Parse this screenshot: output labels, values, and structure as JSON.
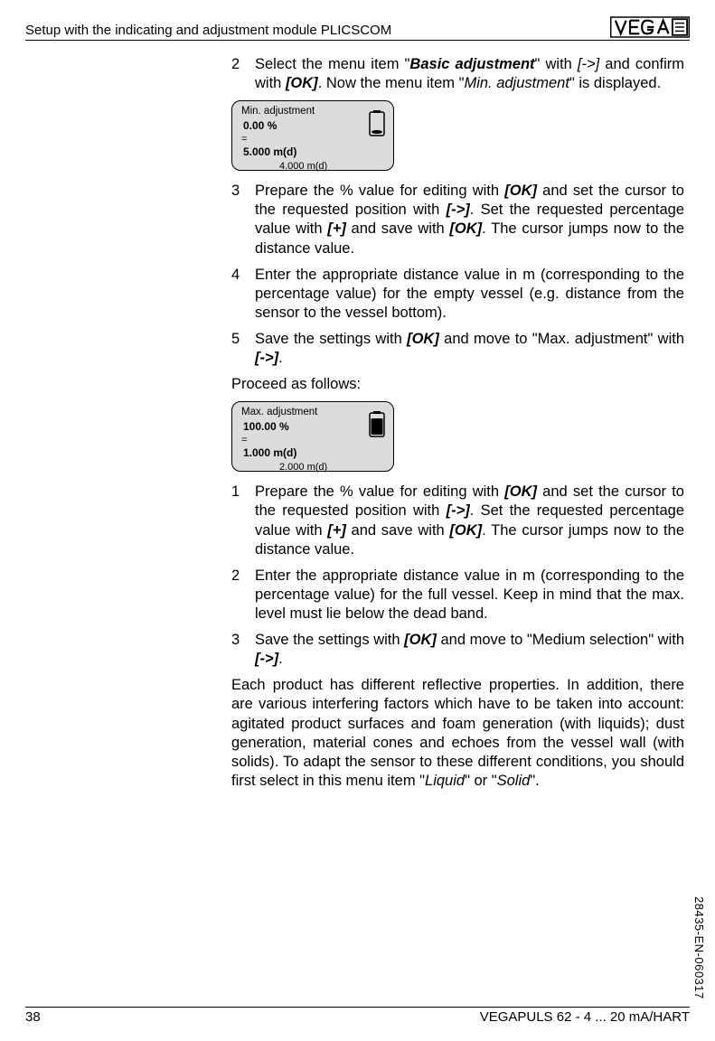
{
  "header": {
    "title": "Setup with the indicating and adjustment module PLICSCOM"
  },
  "steps_a": [
    {
      "num": "2",
      "parts": [
        {
          "t": "Select the menu item \""
        },
        {
          "t": "Basic adjustment",
          "cls": "bolditalic"
        },
        {
          "t": "\" with "
        },
        {
          "t": "[->]",
          "cls": "italic"
        },
        {
          "t": " and confirm with "
        },
        {
          "t": "[OK]",
          "cls": "bolditalic"
        },
        {
          "t": ". Now the menu item \""
        },
        {
          "t": "Min. adjustment",
          "cls": "italic"
        },
        {
          "t": "\" is displayed."
        }
      ]
    }
  ],
  "display1": {
    "title": "Min. adjustment",
    "percent": "0.00 %",
    "eq": "=",
    "dist": "5.000 m(d)",
    "small": "4.000 m(d)"
  },
  "steps_b": [
    {
      "num": "3",
      "parts": [
        {
          "t": "Prepare the % value for editing with "
        },
        {
          "t": "[OK]",
          "cls": "bolditalic"
        },
        {
          "t": " and set the cursor to the requested position with "
        },
        {
          "t": "[->]",
          "cls": "bolditalic"
        },
        {
          "t": ". Set the requested percentage value with "
        },
        {
          "t": "[+]",
          "cls": "bolditalic"
        },
        {
          "t": " and save with "
        },
        {
          "t": "[OK]",
          "cls": "bolditalic"
        },
        {
          "t": ". The cursor jumps now to the distance value."
        }
      ]
    },
    {
      "num": "4",
      "parts": [
        {
          "t": "Enter the appropriate distance value in m (corresponding to the percentage value) for the empty vessel (e.g. distance from the sensor to the vessel bottom)."
        }
      ]
    },
    {
      "num": "5",
      "parts": [
        {
          "t": "Save the settings with "
        },
        {
          "t": "[OK]",
          "cls": "bolditalic"
        },
        {
          "t": " and move to \"Max. adjustment\" with "
        },
        {
          "t": "[->]",
          "cls": "bolditalic"
        },
        {
          "t": "."
        }
      ]
    }
  ],
  "proceed": "Proceed as follows:",
  "display2": {
    "title": "Max. adjustment",
    "percent": "100.00 %",
    "eq": "=",
    "dist": "1.000 m(d)",
    "small": "2.000 m(d)"
  },
  "steps_c": [
    {
      "num": "1",
      "parts": [
        {
          "t": "Prepare the % value for editing with "
        },
        {
          "t": "[OK]",
          "cls": "bolditalic"
        },
        {
          "t": " and set the cursor to the requested position with "
        },
        {
          "t": "[->]",
          "cls": "bolditalic"
        },
        {
          "t": ". Set the requested percentage value with "
        },
        {
          "t": "[+]",
          "cls": "bolditalic"
        },
        {
          "t": " and save with "
        },
        {
          "t": "[OK]",
          "cls": "bolditalic"
        },
        {
          "t": ". The cursor jumps now to the distance value."
        }
      ]
    },
    {
      "num": "2",
      "parts": [
        {
          "t": "Enter the appropriate distance value in m (corresponding to the percentage value) for the full vessel. Keep in mind that the max. level must lie below the dead band."
        }
      ]
    },
    {
      "num": "3",
      "parts": [
        {
          "t": "Save the settings with "
        },
        {
          "t": "[OK]",
          "cls": "bolditalic"
        },
        {
          "t": " and move to \"Medium selection\" with "
        },
        {
          "t": "[->]",
          "cls": "bolditalic"
        },
        {
          "t": "."
        }
      ]
    }
  ],
  "final_para": [
    {
      "t": "Each product has different reflective properties. In addition, there are various interfering factors which have to be taken into account: agitated product surfaces and foam generation (with liquids); dust generation, material cones and echoes from the vessel wall (with solids). To adapt the sensor to these different conditions, you should first select in this menu item \""
    },
    {
      "t": "Liquid",
      "cls": "italic"
    },
    {
      "t": "\" or \""
    },
    {
      "t": "Solid",
      "cls": "italic"
    },
    {
      "t": "\"."
    }
  ],
  "footer": {
    "page": "38",
    "product": "VEGAPULS 62 - 4 ... 20 mA/HART"
  },
  "vertical_code": "28435-EN-060317"
}
